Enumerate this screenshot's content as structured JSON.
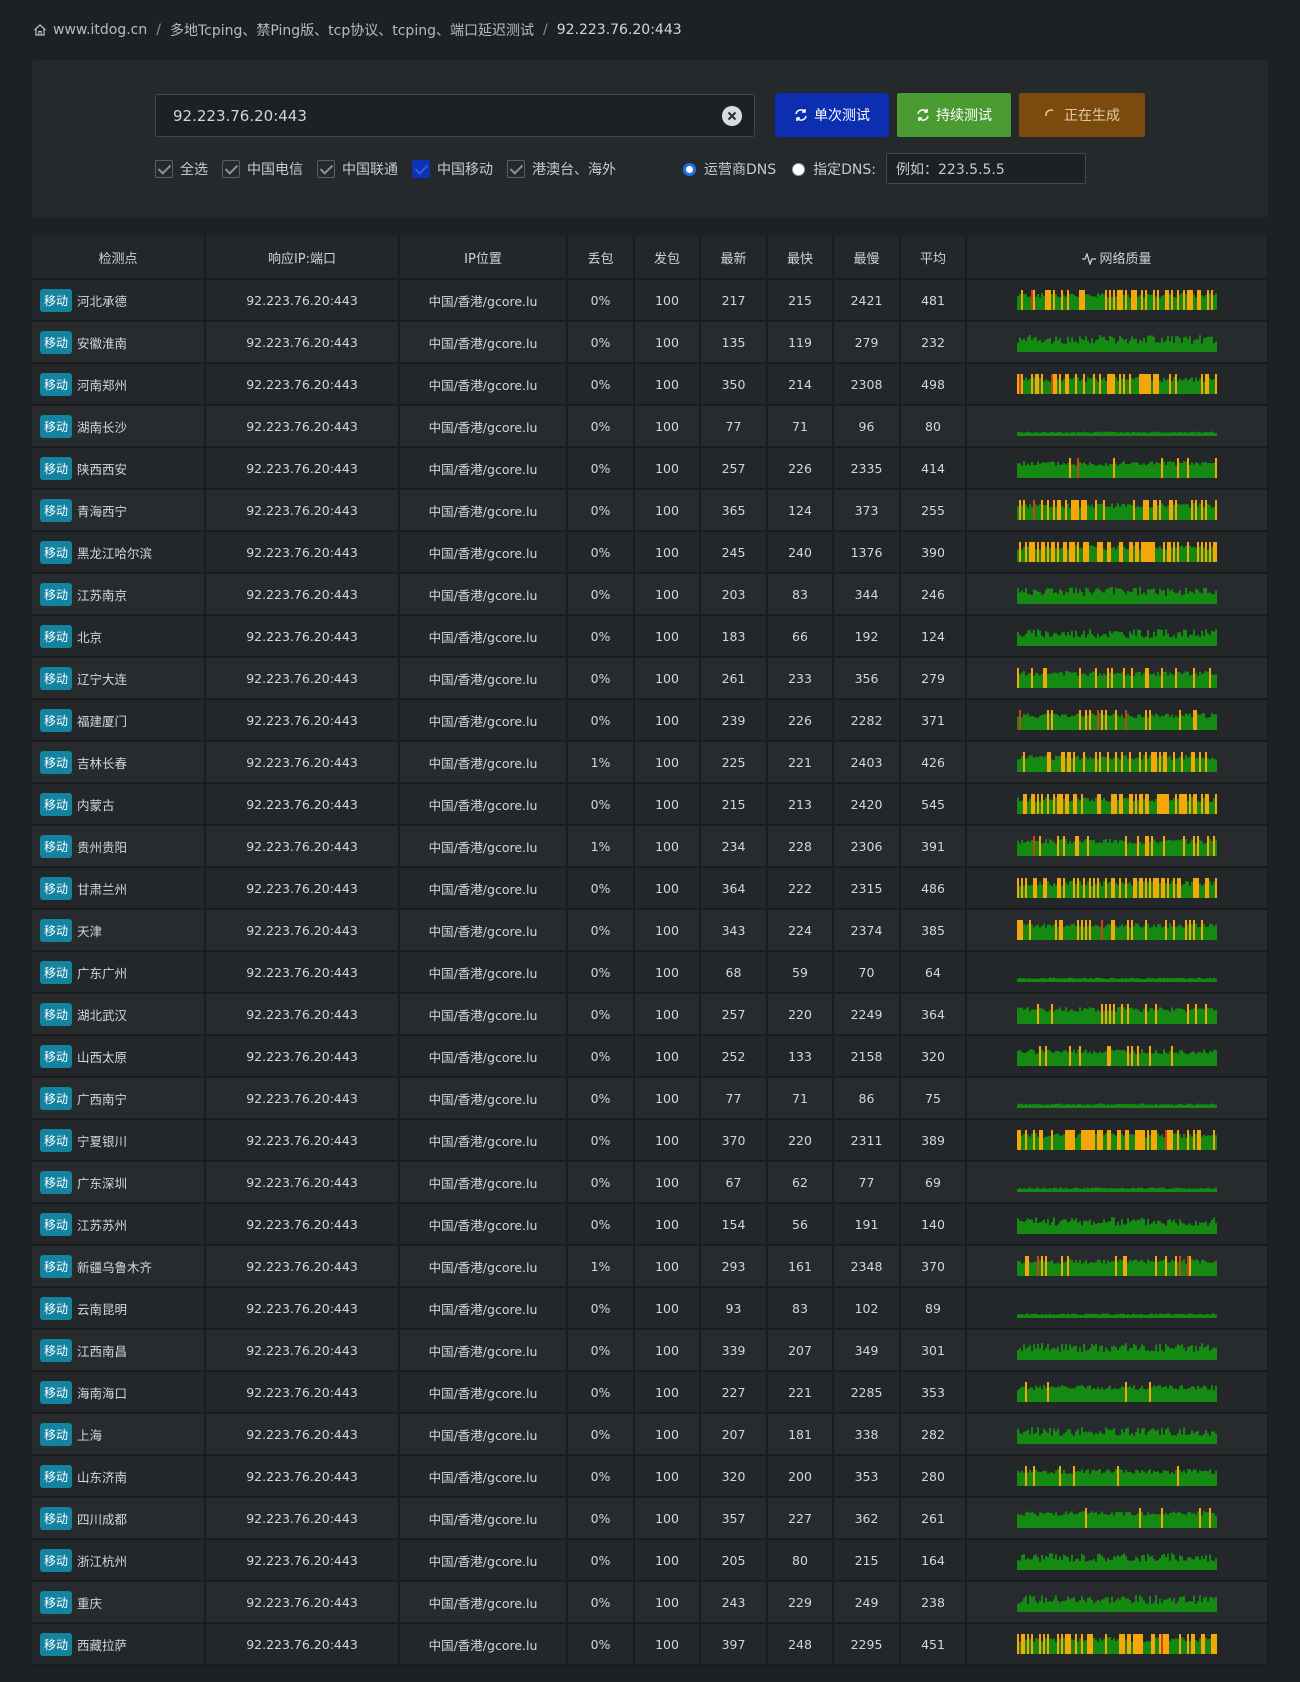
{
  "breadcrumb": {
    "home": "www.itdog.cn",
    "section": "多地Tcping、禁Ping版、tcp协议、tcping、端口延迟测试",
    "current": "92.223.76.20:443",
    "separator": "/"
  },
  "search": {
    "value": "92.223.76.20:443"
  },
  "buttons": {
    "single": "单次测试",
    "continuous": "持续测试",
    "generating": "正在生成"
  },
  "filters": [
    {
      "label": "全选",
      "checked": true
    },
    {
      "label": "中国电信",
      "checked": true
    },
    {
      "label": "中国联通",
      "checked": true
    },
    {
      "label": "中国移动",
      "checked": true,
      "highlight": true
    },
    {
      "label": "港澳台、海外",
      "checked": true
    }
  ],
  "dns": {
    "isp_label": "运营商DNS",
    "custom_label": "指定DNS:",
    "custom_placeholder": "例如：223.5.5.5"
  },
  "table": {
    "headers": [
      "检测点",
      "响应IP:端口",
      "IP位置",
      "丢包",
      "发包",
      "最新",
      "最快",
      "最慢",
      "平均",
      "网络质量"
    ],
    "rows": [
      {
        "isp": "移动",
        "station": "河北承德",
        "ip": "92.223.76.20:443",
        "location": "中国/香港/gcore.lu",
        "loss": "0%",
        "sent": "100",
        "latest": "217",
        "fastest": "215",
        "slowest": "2421",
        "avg": "481",
        "q": 0.4
      },
      {
        "isp": "移动",
        "station": "安徽淮南",
        "ip": "92.223.76.20:443",
        "location": "中国/香港/gcore.lu",
        "loss": "0%",
        "sent": "100",
        "latest": "135",
        "fastest": "119",
        "slowest": "279",
        "avg": "232",
        "q": 0.0
      },
      {
        "isp": "移动",
        "station": "河南郑州",
        "ip": "92.223.76.20:443",
        "location": "中国/香港/gcore.lu",
        "loss": "0%",
        "sent": "100",
        "latest": "350",
        "fastest": "214",
        "slowest": "2308",
        "avg": "498",
        "q": 0.38
      },
      {
        "isp": "移动",
        "station": "湖南长沙",
        "ip": "92.223.76.20:443",
        "location": "中国/香港/gcore.lu",
        "loss": "0%",
        "sent": "100",
        "latest": "77",
        "fastest": "71",
        "slowest": "96",
        "avg": "80",
        "q": 0.0
      },
      {
        "isp": "移动",
        "station": "陕西西安",
        "ip": "92.223.76.20:443",
        "location": "中国/香港/gcore.lu",
        "loss": "0%",
        "sent": "100",
        "latest": "257",
        "fastest": "226",
        "slowest": "2335",
        "avg": "414",
        "q": 0.12
      },
      {
        "isp": "移动",
        "station": "青海西宁",
        "ip": "92.223.76.20:443",
        "location": "中国/香港/gcore.lu",
        "loss": "0%",
        "sent": "100",
        "latest": "365",
        "fastest": "124",
        "slowest": "373",
        "avg": "255",
        "q": 0.3
      },
      {
        "isp": "移动",
        "station": "黑龙江哈尔滨",
        "ip": "92.223.76.20:443",
        "location": "中国/香港/gcore.lu",
        "loss": "0%",
        "sent": "100",
        "latest": "245",
        "fastest": "240",
        "slowest": "1376",
        "avg": "390",
        "q": 0.45
      },
      {
        "isp": "移动",
        "station": "江苏南京",
        "ip": "92.223.76.20:443",
        "location": "中国/香港/gcore.lu",
        "loss": "0%",
        "sent": "100",
        "latest": "203",
        "fastest": "83",
        "slowest": "344",
        "avg": "246",
        "q": 0.0
      },
      {
        "isp": "移动",
        "station": "北京",
        "ip": "92.223.76.20:443",
        "location": "中国/香港/gcore.lu",
        "loss": "0%",
        "sent": "100",
        "latest": "183",
        "fastest": "66",
        "slowest": "192",
        "avg": "124",
        "q": 0.0
      },
      {
        "isp": "移动",
        "station": "辽宁大连",
        "ip": "92.223.76.20:443",
        "location": "中国/香港/gcore.lu",
        "loss": "0%",
        "sent": "100",
        "latest": "261",
        "fastest": "233",
        "slowest": "356",
        "avg": "279",
        "q": 0.18
      },
      {
        "isp": "移动",
        "station": "福建厦门",
        "ip": "92.223.76.20:443",
        "location": "中国/香港/gcore.lu",
        "loss": "0%",
        "sent": "100",
        "latest": "239",
        "fastest": "226",
        "slowest": "2282",
        "avg": "371",
        "q": 0.1
      },
      {
        "isp": "移动",
        "station": "吉林长春",
        "ip": "92.223.76.20:443",
        "location": "中国/香港/gcore.lu",
        "loss": "1%",
        "sent": "100",
        "latest": "225",
        "fastest": "221",
        "slowest": "2403",
        "avg": "426",
        "q": 0.25
      },
      {
        "isp": "移动",
        "station": "内蒙古",
        "ip": "92.223.76.20:443",
        "location": "中国/香港/gcore.lu",
        "loss": "0%",
        "sent": "100",
        "latest": "215",
        "fastest": "213",
        "slowest": "2420",
        "avg": "545",
        "q": 0.45
      },
      {
        "isp": "移动",
        "station": "贵州贵阳",
        "ip": "92.223.76.20:443",
        "location": "中国/香港/gcore.lu",
        "loss": "1%",
        "sent": "100",
        "latest": "234",
        "fastest": "228",
        "slowest": "2306",
        "avg": "391",
        "q": 0.15
      },
      {
        "isp": "移动",
        "station": "甘肃兰州",
        "ip": "92.223.76.20:443",
        "location": "中国/香港/gcore.lu",
        "loss": "0%",
        "sent": "100",
        "latest": "364",
        "fastest": "222",
        "slowest": "2315",
        "avg": "486",
        "q": 0.45
      },
      {
        "isp": "移动",
        "station": "天津",
        "ip": "92.223.76.20:443",
        "location": "中国/香港/gcore.lu",
        "loss": "0%",
        "sent": "100",
        "latest": "343",
        "fastest": "224",
        "slowest": "2374",
        "avg": "385",
        "q": 0.22
      },
      {
        "isp": "移动",
        "station": "广东广州",
        "ip": "92.223.76.20:443",
        "location": "中国/香港/gcore.lu",
        "loss": "0%",
        "sent": "100",
        "latest": "68",
        "fastest": "59",
        "slowest": "70",
        "avg": "64",
        "q": 0.0
      },
      {
        "isp": "移动",
        "station": "湖北武汉",
        "ip": "92.223.76.20:443",
        "location": "中国/香港/gcore.lu",
        "loss": "0%",
        "sent": "100",
        "latest": "257",
        "fastest": "220",
        "slowest": "2249",
        "avg": "364",
        "q": 0.1
      },
      {
        "isp": "移动",
        "station": "山西太原",
        "ip": "92.223.76.20:443",
        "location": "中国/香港/gcore.lu",
        "loss": "0%",
        "sent": "100",
        "latest": "252",
        "fastest": "133",
        "slowest": "2158",
        "avg": "320",
        "q": 0.12
      },
      {
        "isp": "移动",
        "station": "广西南宁",
        "ip": "92.223.76.20:443",
        "location": "中国/香港/gcore.lu",
        "loss": "0%",
        "sent": "100",
        "latest": "77",
        "fastest": "71",
        "slowest": "86",
        "avg": "75",
        "q": 0.0
      },
      {
        "isp": "移动",
        "station": "宁夏银川",
        "ip": "92.223.76.20:443",
        "location": "中国/香港/gcore.lu",
        "loss": "0%",
        "sent": "100",
        "latest": "370",
        "fastest": "220",
        "slowest": "2311",
        "avg": "389",
        "q": 0.35
      },
      {
        "isp": "移动",
        "station": "广东深圳",
        "ip": "92.223.76.20:443",
        "location": "中国/香港/gcore.lu",
        "loss": "0%",
        "sent": "100",
        "latest": "67",
        "fastest": "62",
        "slowest": "77",
        "avg": "69",
        "q": 0.0
      },
      {
        "isp": "移动",
        "station": "江苏苏州",
        "ip": "92.223.76.20:443",
        "location": "中国/香港/gcore.lu",
        "loss": "0%",
        "sent": "100",
        "latest": "154",
        "fastest": "56",
        "slowest": "191",
        "avg": "140",
        "q": 0.0
      },
      {
        "isp": "移动",
        "station": "新疆乌鲁木齐",
        "ip": "92.223.76.20:443",
        "location": "中国/香港/gcore.lu",
        "loss": "1%",
        "sent": "100",
        "latest": "293",
        "fastest": "161",
        "slowest": "2348",
        "avg": "370",
        "q": 0.15
      },
      {
        "isp": "移动",
        "station": "云南昆明",
        "ip": "92.223.76.20:443",
        "location": "中国/香港/gcore.lu",
        "loss": "0%",
        "sent": "100",
        "latest": "93",
        "fastest": "83",
        "slowest": "102",
        "avg": "89",
        "q": 0.0
      },
      {
        "isp": "移动",
        "station": "江西南昌",
        "ip": "92.223.76.20:443",
        "location": "中国/香港/gcore.lu",
        "loss": "0%",
        "sent": "100",
        "latest": "339",
        "fastest": "207",
        "slowest": "349",
        "avg": "301",
        "q": 0.0
      },
      {
        "isp": "移动",
        "station": "海南海口",
        "ip": "92.223.76.20:443",
        "location": "中国/香港/gcore.lu",
        "loss": "0%",
        "sent": "100",
        "latest": "227",
        "fastest": "221",
        "slowest": "2285",
        "avg": "353",
        "q": 0.07
      },
      {
        "isp": "移动",
        "station": "上海",
        "ip": "92.223.76.20:443",
        "location": "中国/香港/gcore.lu",
        "loss": "0%",
        "sent": "100",
        "latest": "207",
        "fastest": "181",
        "slowest": "338",
        "avg": "282",
        "q": 0.0
      },
      {
        "isp": "移动",
        "station": "山东济南",
        "ip": "92.223.76.20:443",
        "location": "中国/香港/gcore.lu",
        "loss": "0%",
        "sent": "100",
        "latest": "320",
        "fastest": "200",
        "slowest": "353",
        "avg": "280",
        "q": 0.05
      },
      {
        "isp": "移动",
        "station": "四川成都",
        "ip": "92.223.76.20:443",
        "location": "中国/香港/gcore.lu",
        "loss": "0%",
        "sent": "100",
        "latest": "357",
        "fastest": "227",
        "slowest": "362",
        "avg": "261",
        "q": 0.05
      },
      {
        "isp": "移动",
        "station": "浙江杭州",
        "ip": "92.223.76.20:443",
        "location": "中国/香港/gcore.lu",
        "loss": "0%",
        "sent": "100",
        "latest": "205",
        "fastest": "80",
        "slowest": "215",
        "avg": "164",
        "q": 0.0
      },
      {
        "isp": "移动",
        "station": "重庆",
        "ip": "92.223.76.20:443",
        "location": "中国/香港/gcore.lu",
        "loss": "0%",
        "sent": "100",
        "latest": "243",
        "fastest": "229",
        "slowest": "249",
        "avg": "238",
        "q": 0.0
      },
      {
        "isp": "移动",
        "station": "西藏拉萨",
        "ip": "92.223.76.20:443",
        "location": "中国/香港/gcore.lu",
        "loss": "0%",
        "sent": "100",
        "latest": "397",
        "fastest": "248",
        "slowest": "2295",
        "avg": "451",
        "q": 0.4
      }
    ]
  },
  "colors": {
    "good": "#148a12",
    "warn": "#f5a70a",
    "bad": "#c7451a",
    "badge": "#1383a0"
  }
}
